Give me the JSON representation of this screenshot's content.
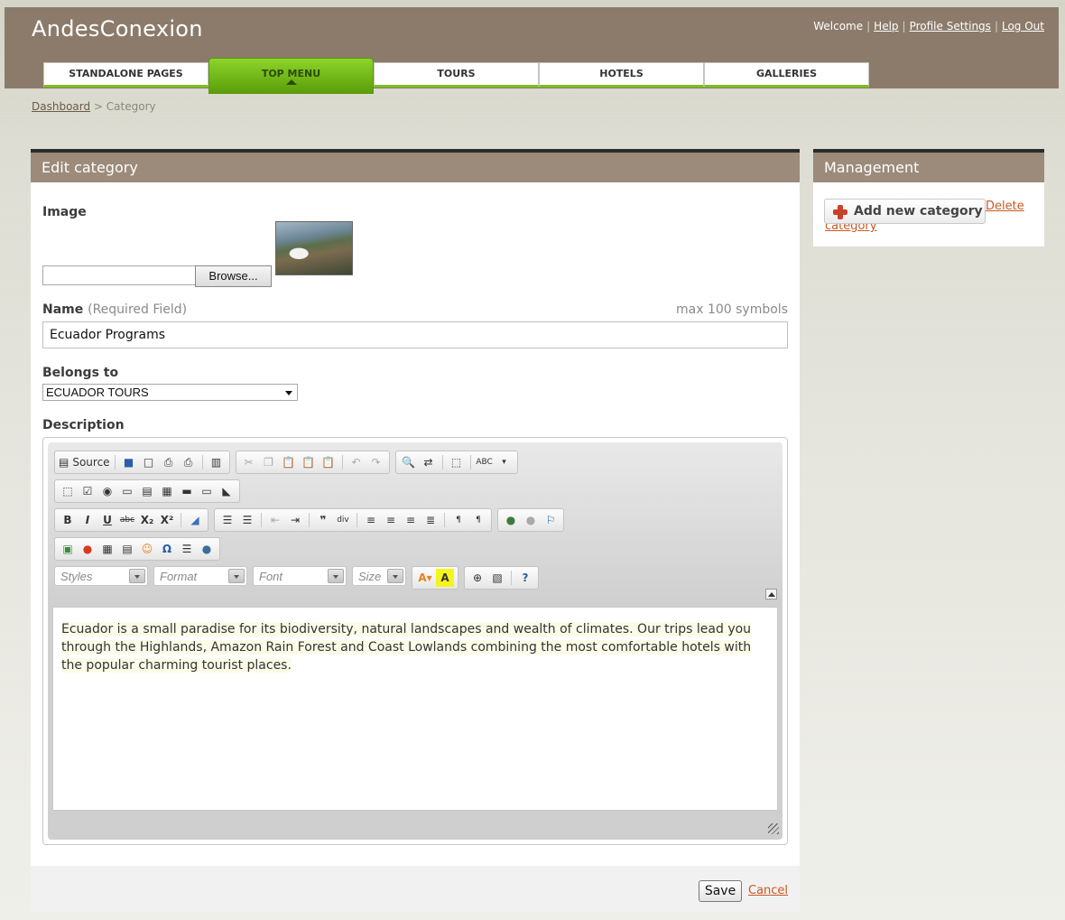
{
  "header": {
    "app_title": "AndesConexion",
    "welcome": "Welcome",
    "help": "Help",
    "profile_settings": "Profile Settings",
    "log_out": "Log Out"
  },
  "tabs": [
    {
      "label": "STANDALONE PAGES",
      "active": false
    },
    {
      "label": "TOP MENU",
      "active": true
    },
    {
      "label": "TOURS",
      "active": false
    },
    {
      "label": "HOTELS",
      "active": false
    },
    {
      "label": "GALLERIES",
      "active": false
    }
  ],
  "breadcrumb": {
    "dashboard": "Dashboard",
    "separator": " > ",
    "current": "Category"
  },
  "edit_panel": {
    "title": "Edit category",
    "image_label": "Image",
    "browse_label": "Browse...",
    "file_value": "",
    "name_label": "Name",
    "name_note": "(Required Field)",
    "name_max": "max 100 symbols",
    "name_value": "Ecuador Programs",
    "belongs_label": "Belongs to",
    "belongs_value": "ECUADOR TOURS",
    "description_label": "Description",
    "description_text": "Ecuador is a small paradise for its biodiversity, natural landscapes and wealth of climates. Our trips lead you through the Highlands, Amazon Rain Forest and Coast Lowlands combining the most comfortable hotels with the popular charming tourist places.",
    "save_label": "Save",
    "cancel_label": "Cancel"
  },
  "editor_toolbar": {
    "source_label": "Source",
    "bold": "B",
    "italic": "I",
    "underline": "U",
    "strike": "abc",
    "subscript": "X₂",
    "superscript": "X²",
    "styles_placeholder": "Styles",
    "format_placeholder": "Format",
    "font_placeholder": "Font",
    "size_placeholder": "Size",
    "spell_label": "ABC"
  },
  "management": {
    "title": "Management",
    "add_label": "Add new category",
    "delete_label": "Delete category"
  },
  "colors": {
    "header_bg": "#8c7b6b",
    "panel_head": "#9c8b7a",
    "tab_active": "#7cbd1a",
    "link": "#c65a22"
  }
}
